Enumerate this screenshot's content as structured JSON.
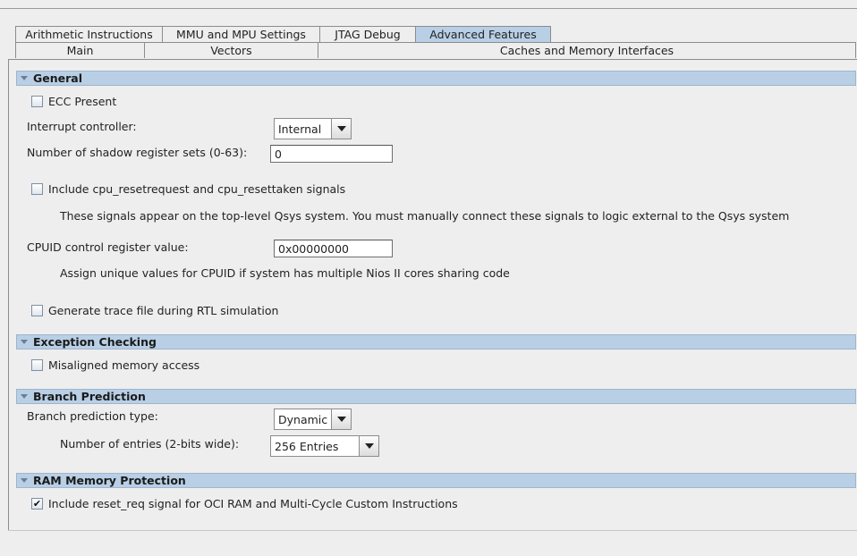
{
  "tabs": {
    "row1": [
      "Arithmetic Instructions",
      "MMU and MPU Settings",
      "JTAG Debug",
      "Advanced Features"
    ],
    "row2": [
      "Main",
      "Vectors",
      "Caches and Memory Interfaces"
    ],
    "active": "Advanced Features"
  },
  "general": {
    "title": "General",
    "ecc_present": {
      "label": "ECC Present",
      "checked": false
    },
    "interrupt_controller": {
      "label": "Interrupt controller:",
      "value": "Internal"
    },
    "shadow_register_sets": {
      "label": "Number of shadow register sets (0-63):",
      "value": "0"
    },
    "reset_signals": {
      "label": "Include cpu_resetrequest and cpu_resettaken signals",
      "checked": false
    },
    "reset_signals_note": "These signals appear on the top-level Qsys system. You must manually connect these signals to logic external to the Qsys system",
    "cpuid": {
      "label": "CPUID control register value:",
      "value": "0x00000000"
    },
    "cpuid_note": "Assign unique values for CPUID if system has multiple Nios II cores sharing code",
    "trace_file": {
      "label": "Generate trace file during RTL simulation",
      "checked": false
    }
  },
  "exception_checking": {
    "title": "Exception Checking",
    "misaligned": {
      "label": "Misaligned memory access",
      "checked": false
    }
  },
  "branch_prediction": {
    "title": "Branch Prediction",
    "type": {
      "label": "Branch prediction type:",
      "value": "Dynamic"
    },
    "entries": {
      "label": "Number of entries (2-bits wide):",
      "value": "256 Entries"
    }
  },
  "ram_memory_protection": {
    "title": "RAM Memory Protection",
    "reset_req": {
      "label": "Include reset_req signal for OCI RAM and Multi-Cycle Custom Instructions",
      "checked": true,
      "mark": "✔"
    }
  }
}
